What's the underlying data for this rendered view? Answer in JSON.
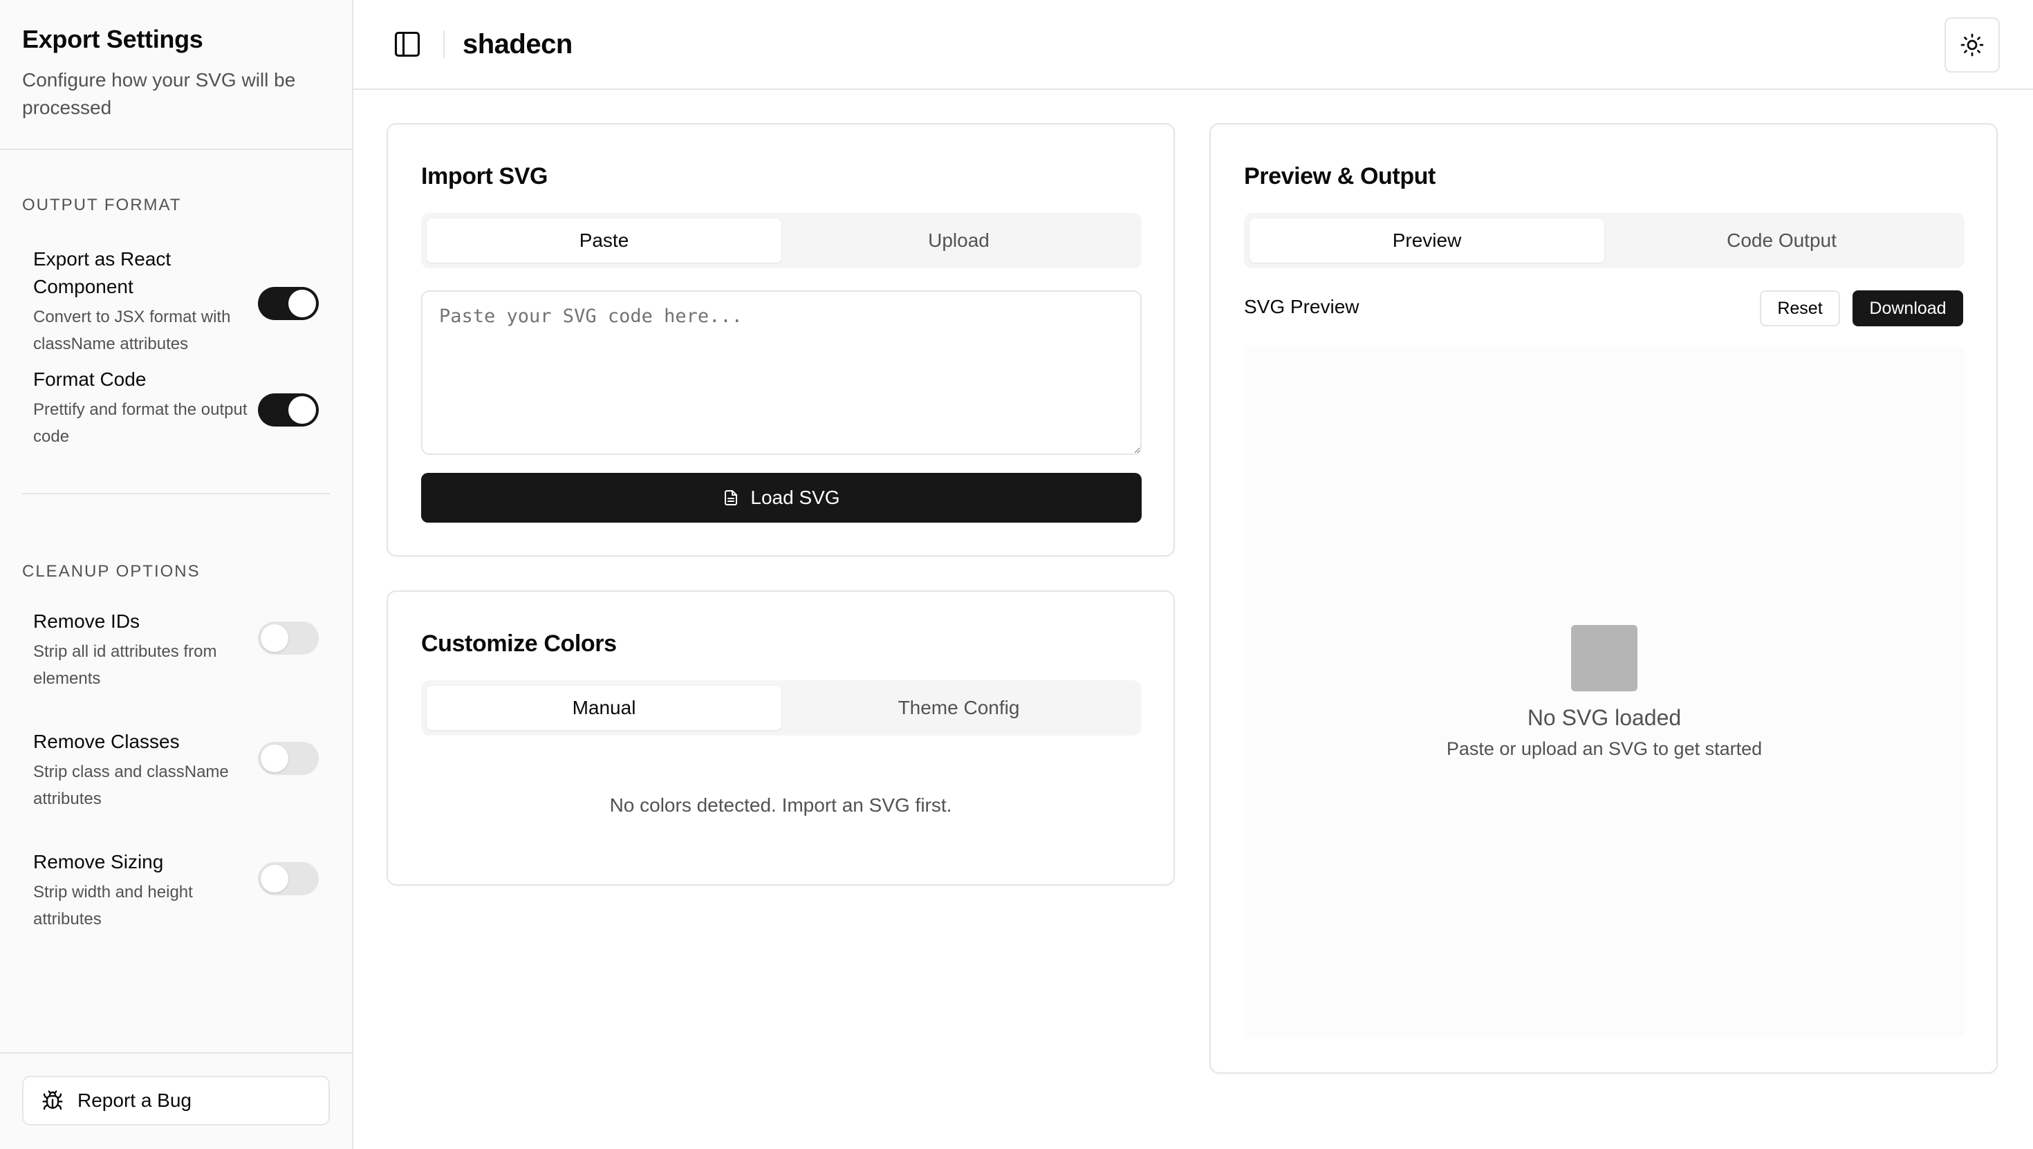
{
  "sidebar": {
    "title": "Export Settings",
    "description": "Configure how your SVG will be processed",
    "output_section_title": "OUTPUT FORMAT",
    "output_options": [
      {
        "label": "Export as React Component",
        "description": "Convert to JSX format with className attributes",
        "enabled": true
      },
      {
        "label": "Format Code",
        "description": "Prettify and format the output code",
        "enabled": true
      }
    ],
    "cleanup_section_title": "CLEANUP OPTIONS",
    "cleanup_options": [
      {
        "label": "Remove IDs",
        "description": "Strip all id attributes from elements",
        "enabled": false
      },
      {
        "label": "Remove Classes",
        "description": "Strip class and className attributes",
        "enabled": false
      },
      {
        "label": "Remove Sizing",
        "description": "Strip width and height attributes",
        "enabled": false
      }
    ],
    "report_bug_label": "Report a Bug"
  },
  "header": {
    "brand": "shadecn",
    "icons": {
      "sidebar_toggle": "panel-left-icon",
      "theme_toggle": "sun-icon"
    }
  },
  "import_card": {
    "title": "Import SVG",
    "tabs": [
      {
        "label": "Paste",
        "active": true
      },
      {
        "label": "Upload",
        "active": false
      }
    ],
    "placeholder": "Paste your SVG code here...",
    "value": "",
    "load_button_label": "Load SVG"
  },
  "colors_card": {
    "title": "Customize Colors",
    "tabs": [
      {
        "label": "Manual",
        "active": true
      },
      {
        "label": "Theme Config",
        "active": false
      }
    ],
    "empty_message": "No colors detected. Import an SVG first."
  },
  "preview_card": {
    "title": "Preview & Output",
    "tabs": [
      {
        "label": "Preview",
        "active": true
      },
      {
        "label": "Code Output",
        "active": false
      }
    ],
    "preview_label": "SVG Preview",
    "reset_label": "Reset",
    "download_label": "Download",
    "empty_title": "No SVG loaded",
    "empty_subtitle": "Paste or upload an SVG to get started"
  },
  "colors": {
    "primary": "#171717",
    "border": "#e5e5e5",
    "muted": "#f5f5f5",
    "muted_text": "#525252",
    "sidebar_bg": "#fafafa"
  }
}
